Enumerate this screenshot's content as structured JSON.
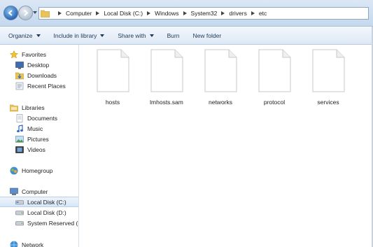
{
  "address": {
    "crumbs": [
      "Computer",
      "Local Disk (C:)",
      "Windows",
      "System32",
      "drivers",
      "etc"
    ]
  },
  "toolbar": {
    "organize": "Organize",
    "include": "Include in library",
    "share": "Share with",
    "burn": "Burn",
    "new_folder": "New folder"
  },
  "nav": {
    "favorites": "Favorites",
    "desktop": "Desktop",
    "downloads": "Downloads",
    "recent": "Recent Places",
    "libraries": "Libraries",
    "documents": "Documents",
    "music": "Music",
    "pictures": "Pictures",
    "videos": "Videos",
    "homegroup": "Homegroup",
    "computer": "Computer",
    "local_c": "Local Disk (C:)",
    "local_d": "Local Disk (D:)",
    "reserved": "System Reserved (F:)",
    "network": "Network"
  },
  "files": [
    "hosts",
    "lmhosts.sam",
    "networks",
    "protocol",
    "services"
  ],
  "colors": {
    "accent": "#2a69b6",
    "toolbar_text": "#1e3956",
    "folder": "#e8c25a"
  }
}
